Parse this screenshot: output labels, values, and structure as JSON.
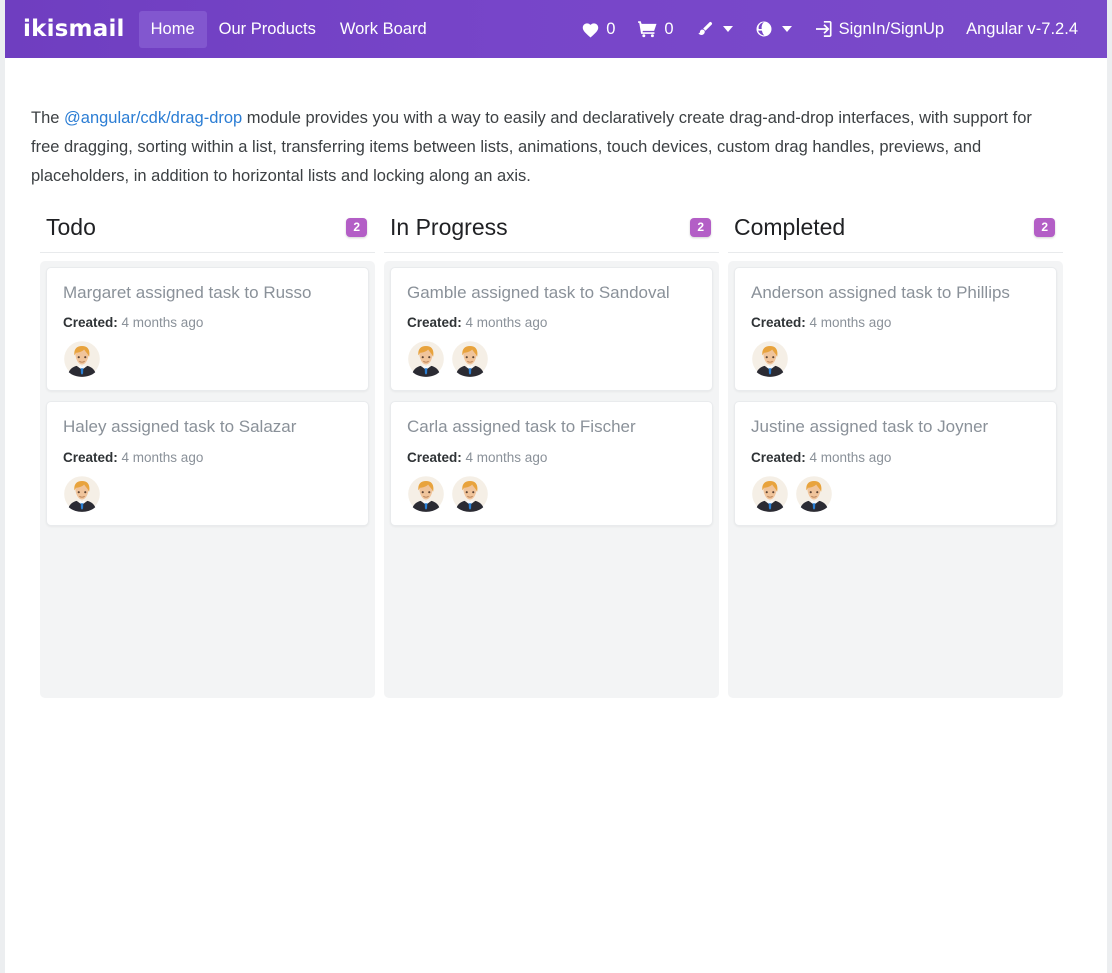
{
  "navbar": {
    "brand": "ikismail",
    "links": [
      {
        "label": "Home",
        "active": true
      },
      {
        "label": "Our Products",
        "active": false
      },
      {
        "label": "Work Board",
        "active": false
      }
    ],
    "wishlist": {
      "icon": "heart-icon",
      "count": "0"
    },
    "cart": {
      "icon": "shopping-cart-icon",
      "count": "0"
    },
    "theme": {
      "icon": "paint-brush-icon"
    },
    "language": {
      "icon": "globe-icon"
    },
    "signin": {
      "icon": "sign-in-icon",
      "label": "SignIn/SignUp"
    },
    "version": "Angular v-7.2.4",
    "brand_color": "#7745c9",
    "active_color": "#8257cf"
  },
  "intro": {
    "before_link": "The ",
    "link_text": "@angular/cdk/drag-drop",
    "after_link": " module provides you with a way to easily and declaratively create drag-and-drop interfaces, with support for free dragging, sorting within a list, transferring items between lists, animations, touch devices, custom drag handles, previews, and placeholders, in addition to horizontal lists and locking along an axis.",
    "link_color": "#2b7dd4"
  },
  "board": {
    "badge_color": "#b35ec6",
    "created_label": "Created:",
    "columns": [
      {
        "title": "Todo",
        "count": "2",
        "cards": [
          {
            "title": "Margaret assigned task to Russo",
            "created": "4 months ago",
            "avatars": 1
          },
          {
            "title": "Haley assigned task to Salazar",
            "created": "4 months ago",
            "avatars": 1
          }
        ]
      },
      {
        "title": "In Progress",
        "count": "2",
        "cards": [
          {
            "title": "Gamble assigned task to Sandoval",
            "created": "4 months ago",
            "avatars": 2
          },
          {
            "title": "Carla assigned task to Fischer",
            "created": "4 months ago",
            "avatars": 2
          }
        ]
      },
      {
        "title": "Completed",
        "count": "2",
        "cards": [
          {
            "title": "Anderson assigned task to Phillips",
            "created": "4 months ago",
            "avatars": 1
          },
          {
            "title": "Justine assigned task to Joyner",
            "created": "4 months ago",
            "avatars": 2
          }
        ]
      }
    ]
  }
}
